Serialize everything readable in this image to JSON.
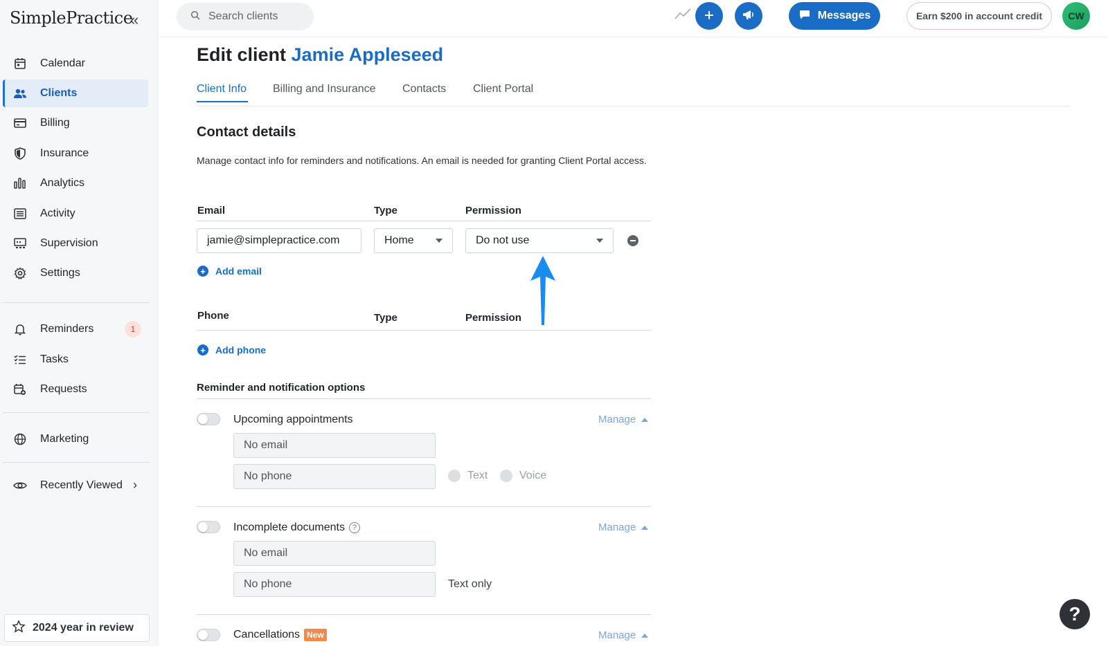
{
  "brand": {
    "name": "SimplePractice"
  },
  "sidebar": {
    "items": [
      {
        "label": "Calendar",
        "icon": "calendar-icon"
      },
      {
        "label": "Clients",
        "icon": "users-icon",
        "active": true
      },
      {
        "label": "Billing",
        "icon": "credit-card-icon"
      },
      {
        "label": "Insurance",
        "icon": "shield-icon"
      },
      {
        "label": "Analytics",
        "icon": "bar-chart-icon"
      },
      {
        "label": "Activity",
        "icon": "list-icon"
      },
      {
        "label": "Supervision",
        "icon": "supervision-icon"
      },
      {
        "label": "Settings",
        "icon": "gear-icon"
      }
    ],
    "secondary": [
      {
        "label": "Reminders",
        "icon": "bell-icon",
        "badge": "1"
      },
      {
        "label": "Tasks",
        "icon": "checklist-icon"
      },
      {
        "label": "Requests",
        "icon": "calendar-plus-icon"
      }
    ],
    "marketing": {
      "label": "Marketing",
      "icon": "globe-icon"
    },
    "recently_viewed": {
      "label": "Recently Viewed",
      "icon": "eye-icon"
    },
    "year_review": {
      "label": "2024 year in review",
      "icon": "star-icon"
    }
  },
  "topbar": {
    "search_placeholder": "Search clients",
    "messages_label": "Messages",
    "credit_label": "Earn $200 in account credit",
    "avatar_initials": "CW"
  },
  "page": {
    "title_prefix": "Edit client",
    "client_name": "Jamie Appleseed",
    "tabs": [
      {
        "label": "Client Info",
        "active": true
      },
      {
        "label": "Billing and Insurance"
      },
      {
        "label": "Contacts"
      },
      {
        "label": "Client Portal"
      }
    ]
  },
  "contact": {
    "heading": "Contact details",
    "description": "Manage contact info for reminders and notifications. An email is needed for granting Client Portal access.",
    "email_header": "Email",
    "type_header": "Type",
    "permission_header": "Permission",
    "email_value": "jamie@simplepractice.com",
    "email_type": "Home",
    "email_permission": "Do not use",
    "add_email_label": "Add email",
    "phone_header": "Phone",
    "phone_type_header": "Type",
    "phone_permission_header": "Permission",
    "add_phone_label": "Add phone"
  },
  "reminders": {
    "heading": "Reminder and notification options",
    "manage_label": "Manage",
    "upcoming": {
      "label": "Upcoming appointments",
      "email": "No email",
      "phone": "No phone",
      "text_label": "Text",
      "voice_label": "Voice"
    },
    "incomplete": {
      "label": "Incomplete documents",
      "email": "No email",
      "phone": "No phone",
      "text_only_label": "Text only"
    },
    "cancellations": {
      "label": "Cancellations",
      "new_tag": "New"
    }
  },
  "help_fab": "?",
  "colors": {
    "accent": "#1a6cc4",
    "arrow": "#1a8cf0",
    "badge_bg": "#fde2dc",
    "new_tag": "#f28a4a"
  }
}
